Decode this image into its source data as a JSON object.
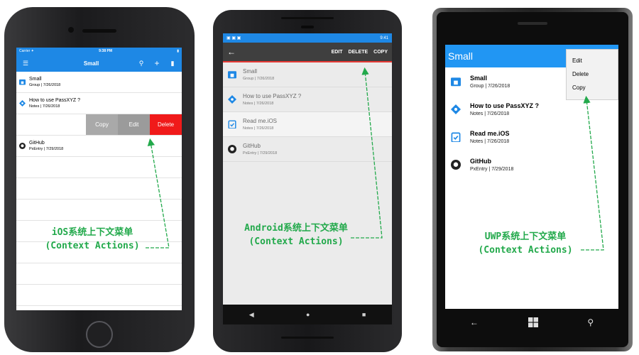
{
  "colors": {
    "ios_bar": "#1e88e5",
    "android_bar": "#3f3f3f",
    "android_status": "#1e88e5",
    "uwp_header": "#2196f3",
    "action_copy": "#a9a9a9",
    "action_edit": "#9b9b9b",
    "action_delete": "#f01a1a",
    "annotation": "#22a94b"
  },
  "ios": {
    "status": {
      "carrier": "Carrier ✦",
      "time": "9:38 PM",
      "battery": "▮"
    },
    "nav": {
      "title": "Small",
      "menu_icon": "hamburger-icon",
      "search_icon": "search-icon",
      "add_icon": "plus-icon",
      "side_icon": "panel-icon"
    },
    "items": [
      {
        "name": "Small",
        "detail": "Group | 7/26/2018",
        "icon": "folder-icon"
      },
      {
        "name": "How to use PassXYZ ?",
        "detail": "Notes | 7/26/2018",
        "icon": "tag-icon"
      },
      {
        "name": "GitHub",
        "detail": "PxEntry | 7/29/2018",
        "icon": "github-icon"
      }
    ],
    "actions": {
      "copy": "Copy",
      "edit": "Edit",
      "delete": "Delete"
    },
    "annotation": {
      "line1": "iOS系统上下文菜单",
      "line2": "(Context Actions)"
    }
  },
  "android": {
    "status": {
      "left": "▣ ▣ ▣",
      "time": "9:41"
    },
    "bar": {
      "back": "←",
      "edit": "EDIT",
      "delete": "DELETE",
      "copy": "COPY"
    },
    "items": [
      {
        "name": "Small",
        "detail": "Group | 7/26/2018",
        "icon": "folder-icon"
      },
      {
        "name": "How to use PassXYZ ?",
        "detail": "Notes | 7/26/2018",
        "icon": "tag-icon"
      },
      {
        "name": "Read me.iOS",
        "detail": "Notes | 7/26/2018",
        "icon": "clipboard-icon"
      },
      {
        "name": "GitHub",
        "detail": "PxEntry | 7/29/2018",
        "icon": "github-icon"
      }
    ],
    "navbar": {
      "back": "◀",
      "home": "●",
      "recents": "■"
    },
    "annotation": {
      "line1": "Android系统上下文菜单",
      "line2": "(Context Actions)"
    }
  },
  "uwp": {
    "title": "Small",
    "items": [
      {
        "name": "Small",
        "detail": "Group | 7/26/2018",
        "icon": "folder-icon"
      },
      {
        "name": "How to use PassXYZ ?",
        "detail": "Notes | 7/26/2018",
        "icon": "tag-icon"
      },
      {
        "name": "Read me.iOS",
        "detail": "Notes | 7/26/2018",
        "icon": "clipboard-icon"
      },
      {
        "name": "GitHub",
        "detail": "PxEntry | 7/29/2018",
        "icon": "github-icon"
      }
    ],
    "menu": {
      "edit": "Edit",
      "delete": "Delete",
      "copy": "Copy"
    },
    "nav": {
      "back": "←",
      "search": "⚲"
    },
    "annotation": {
      "line1": "UWP系统上下文菜单",
      "line2": "(Context Actions)"
    }
  }
}
